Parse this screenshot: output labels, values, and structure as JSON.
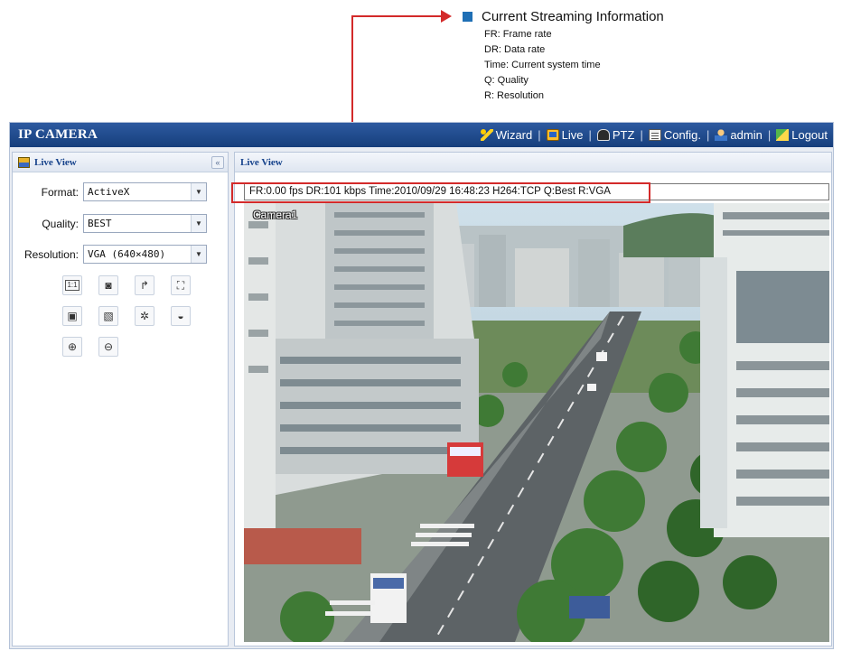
{
  "callout": {
    "title": "Current Streaming Information",
    "items": [
      "FR: Frame rate",
      "DR: Data rate",
      "Time: Current system time",
      "Q: Quality",
      "R: Resolution"
    ],
    "accent": "#d32a2a",
    "bullet_color": "#1f6fb5"
  },
  "app": {
    "title": "IP CAMERA",
    "nav": [
      {
        "label": "Wizard",
        "icon": "wand-icon"
      },
      {
        "label": "Live",
        "icon": "live-icon"
      },
      {
        "label": "PTZ",
        "icon": "ptz-camera-icon"
      },
      {
        "label": "Config.",
        "icon": "config-icon"
      },
      {
        "label": "admin",
        "icon": "user-icon"
      },
      {
        "label": "Logout",
        "icon": "logout-icon"
      }
    ],
    "titlebar_color": "#1f4a8d"
  },
  "left_panel": {
    "title": "Live View",
    "collapse": "«",
    "format": {
      "label": "Format:",
      "value": "ActiveX"
    },
    "quality": {
      "label": "Quality:",
      "value": "BEST"
    },
    "resolution": {
      "label": "Resolution:",
      "value": "VGA (640×480)"
    },
    "tools": [
      {
        "name": "original-size-button",
        "icon": "original-size-icon",
        "glyph": "1:1"
      },
      {
        "name": "snapshot-button",
        "icon": "camera-snapshot-icon",
        "glyph": "◙"
      },
      {
        "name": "rotate-button",
        "icon": "rotate-arrow-icon",
        "glyph": "↱"
      },
      {
        "name": "fullscreen-button",
        "icon": "fullscreen-icon",
        "glyph": "⛶"
      },
      {
        "name": "zoom-area-button",
        "icon": "zoom-area-icon",
        "glyph": "▣"
      },
      {
        "name": "zoom-area-2-button",
        "icon": "zoom-area-alt-icon",
        "glyph": "▧"
      },
      {
        "name": "motion-button",
        "icon": "motion-icon",
        "glyph": "✲"
      },
      {
        "name": "dome-button",
        "icon": "dome-camera-icon",
        "glyph": "◒"
      },
      {
        "name": "zoom-in-button",
        "icon": "zoom-in-icon",
        "glyph": "⊕"
      },
      {
        "name": "zoom-out-button",
        "icon": "zoom-out-icon",
        "glyph": "⊖"
      }
    ]
  },
  "right_panel": {
    "title": "Live View",
    "info_text": "FR:0.00 fps  DR:101 kbps Time:2010/09/29 16:48:23 H264:TCP Q:Best R:VGA",
    "camera_label": "Camera1"
  }
}
